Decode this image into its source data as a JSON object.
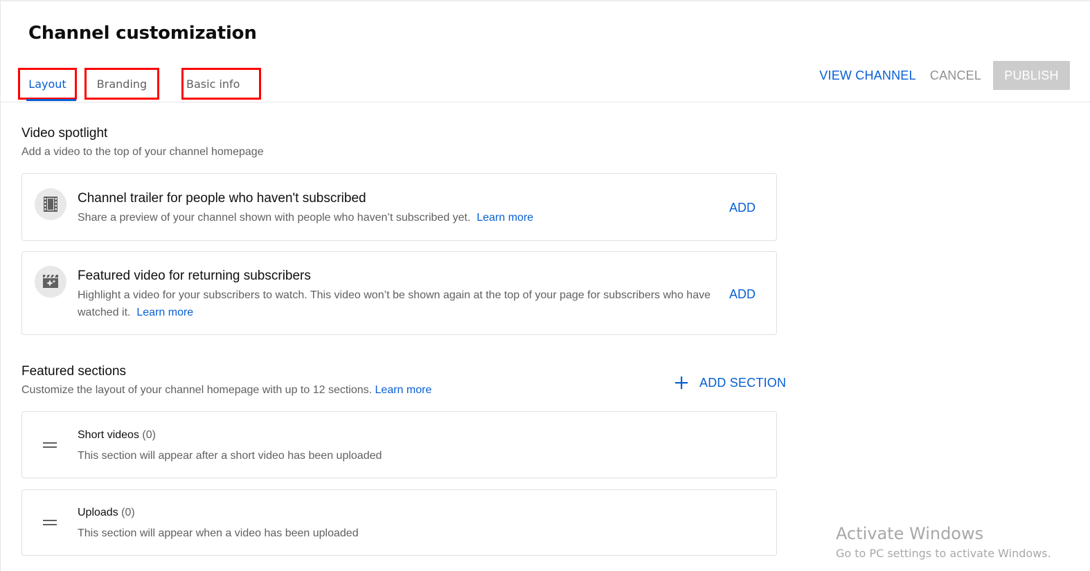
{
  "page": {
    "title": "Channel customization"
  },
  "tabs": [
    {
      "label": "Layout",
      "active": true
    },
    {
      "label": "Branding",
      "active": false
    },
    {
      "label": "Basic info",
      "active": false
    }
  ],
  "header_actions": {
    "view_channel": "VIEW CHANNEL",
    "cancel": "CANCEL",
    "publish": "PUBLISH"
  },
  "video_spotlight": {
    "title": "Video spotlight",
    "subtitle": "Add a video to the top of your channel homepage",
    "cards": [
      {
        "icon": "film-icon",
        "title": "Channel trailer for people who haven't subscribed",
        "description": "Share a preview of your channel shown with people who haven’t subscribed yet.",
        "link": "Learn more",
        "action": "ADD"
      },
      {
        "icon": "clapperboard-sparkle-icon",
        "title": "Featured video for returning subscribers",
        "description": "Highlight a video for your subscribers to watch. This video won’t be shown again at the top of your page for subscribers who have watched it.",
        "link": "Learn more",
        "action": "ADD"
      }
    ]
  },
  "featured_sections": {
    "title": "Featured sections",
    "subtitle": "Customize the layout of your channel homepage with up to 12 sections.",
    "link": "Learn more",
    "add_section": "ADD SECTION",
    "items": [
      {
        "name": "Short videos",
        "count": "(0)",
        "description": "This section will appear after a short video has been uploaded"
      },
      {
        "name": "Uploads",
        "count": "(0)",
        "description": "This section will appear when a video has been uploaded"
      }
    ]
  },
  "watermark": {
    "title": "Activate Windows",
    "subtitle": "Go to PC settings to activate Windows."
  },
  "colors": {
    "accent": "#065fd4",
    "highlight_box": "#ff0000",
    "publish_disabled": "#cccccc"
  }
}
